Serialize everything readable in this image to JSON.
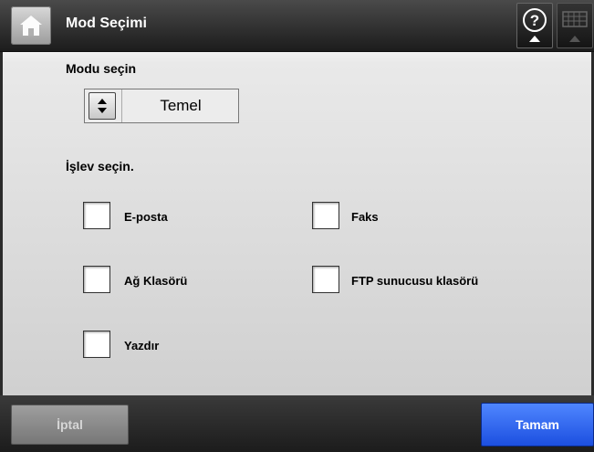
{
  "header": {
    "title": "Mod Seçimi",
    "home_icon": "home-icon",
    "help_icon": "help-icon",
    "keyboard_icon": "keyboard-icon"
  },
  "mode": {
    "label": "Modu seçin",
    "selected": "Temel"
  },
  "function": {
    "label": "İşlev seçin.",
    "options": [
      {
        "label": "E-posta",
        "checked": false
      },
      {
        "label": "Faks",
        "checked": false
      },
      {
        "label": "Ağ Klasörü",
        "checked": false
      },
      {
        "label": "FTP sunucusu klasörü",
        "checked": false
      },
      {
        "label": "Yazdır",
        "checked": false
      }
    ]
  },
  "footer": {
    "cancel_label": "İptal",
    "ok_label": "Tamam"
  },
  "colors": {
    "accent": "#2a5cf0"
  }
}
